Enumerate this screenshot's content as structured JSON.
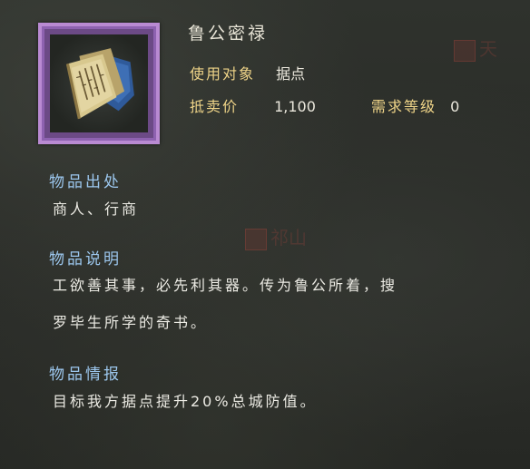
{
  "background_marks": {
    "top_right": "天",
    "middle": "祁山"
  },
  "item": {
    "name": "鲁公密禄",
    "icon": "scroll-icon",
    "frame_color": "#b98ad2",
    "target_label": "使用对象",
    "target_value": "据点",
    "price_label": "抵卖价",
    "price_value": "1,100",
    "level_label": "需求等级",
    "level_value": "0"
  },
  "sections": {
    "source": {
      "title": "物品出处",
      "text": "商人、行商"
    },
    "description": {
      "title": "物品说明",
      "line1": "工欲善其事，必先利其器。传为鲁公所着，搜",
      "line2": "罗毕生所学的奇书。"
    },
    "intel": {
      "title": "物品情报",
      "text": "目标我方据点提升20%总城防值。"
    }
  },
  "colors": {
    "label_gold": "#efd488",
    "section_blue": "#9cc7ee",
    "text_white": "#ecebe4"
  }
}
